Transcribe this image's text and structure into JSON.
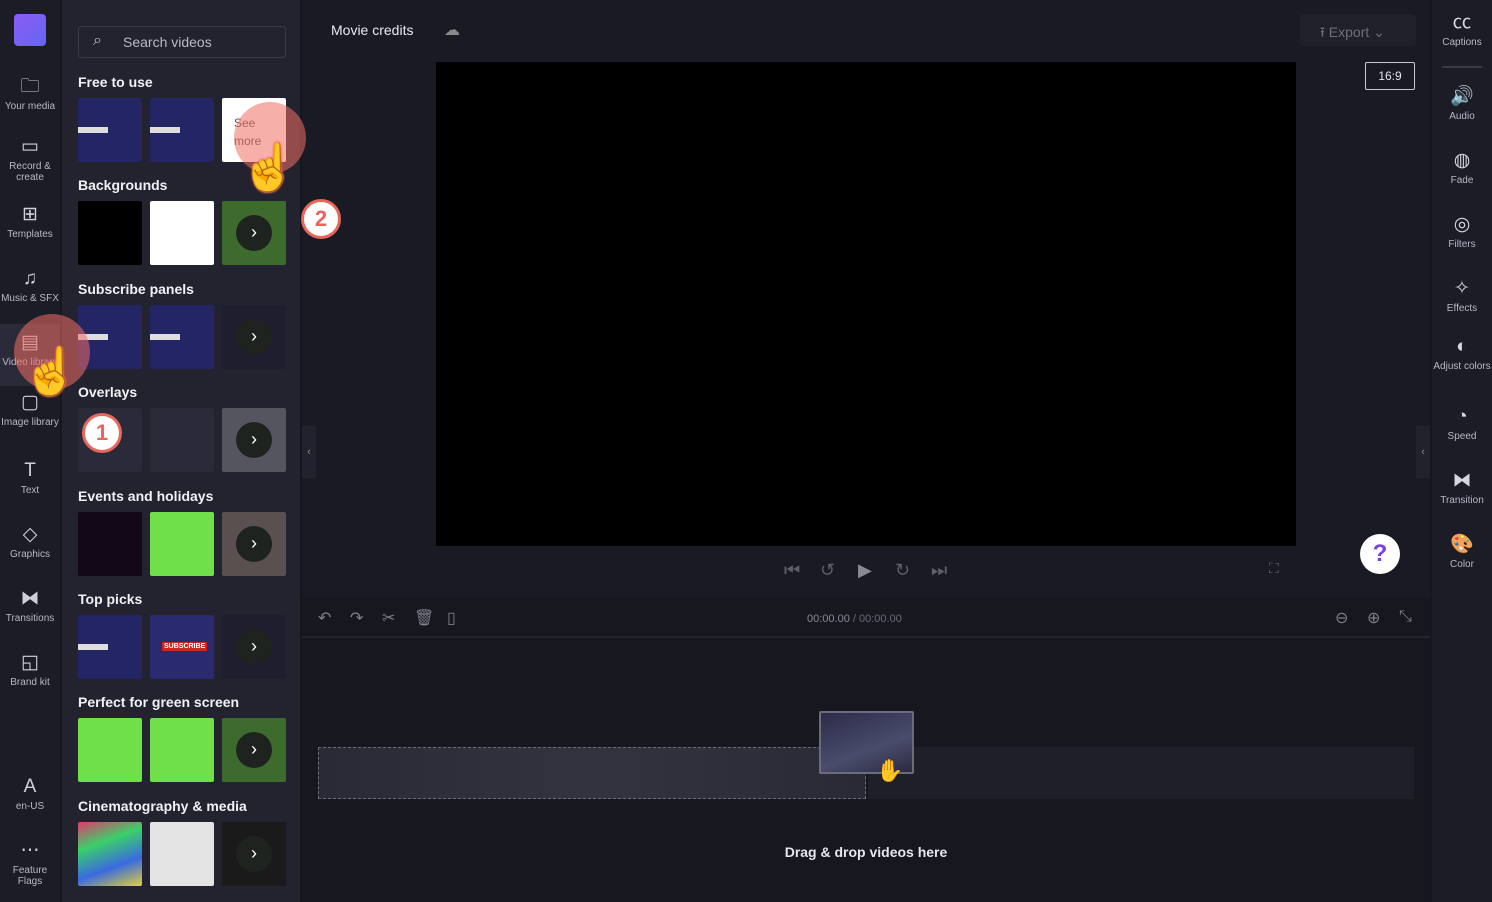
{
  "nav": {
    "items": [
      {
        "label": "Your media",
        "icon": "folder-icon",
        "glyph": "🗀"
      },
      {
        "label": "Record & create",
        "icon": "camera-icon",
        "glyph": "▭"
      },
      {
        "label": "Templates",
        "icon": "templates-icon",
        "glyph": "⊞"
      },
      {
        "label": "Music & SFX",
        "icon": "music-icon",
        "glyph": "♫"
      },
      {
        "label": "Video library",
        "icon": "film-icon",
        "glyph": "▤"
      },
      {
        "label": "Image library",
        "icon": "image-icon",
        "glyph": "▢"
      },
      {
        "label": "Text",
        "icon": "text-icon",
        "glyph": "T"
      },
      {
        "label": "Graphics",
        "icon": "shapes-icon",
        "glyph": "◇"
      },
      {
        "label": "Transitions",
        "icon": "transitions-icon",
        "glyph": "⧓"
      },
      {
        "label": "Brand kit",
        "icon": "brand-icon",
        "glyph": "◱"
      },
      {
        "label": "en-US",
        "icon": "language-icon",
        "glyph": "A"
      },
      {
        "label": "Feature Flags",
        "icon": "more-icon",
        "glyph": "⋯"
      }
    ],
    "active": "Video library"
  },
  "panel": {
    "search_placeholder": "Search videos",
    "see_more": "See more",
    "sections": [
      "Free to use",
      "Backgrounds",
      "Subscribe panels",
      "Overlays",
      "Events and holidays",
      "Top picks",
      "Perfect for green screen",
      "Cinematography & media"
    ],
    "thumb_text": "SUBSCRIBE"
  },
  "editor": {
    "project_title": "Movie credits",
    "export_label": "Export",
    "aspect_ratio": "16:9",
    "help": "?"
  },
  "timeline": {
    "current_time": "00:00.00",
    "total_time": "/ 00:00.00",
    "drop_hint": "Drag & drop videos here"
  },
  "rail": {
    "items": [
      {
        "label": "Captions",
        "icon": "captions-icon",
        "glyph": "㏄"
      },
      {
        "label": "Audio",
        "icon": "speaker-icon",
        "glyph": "🔊"
      },
      {
        "label": "Fade",
        "icon": "fade-icon",
        "glyph": "◍"
      },
      {
        "label": "Filters",
        "icon": "filters-icon",
        "glyph": "◎"
      },
      {
        "label": "Effects",
        "icon": "magic-wand-icon",
        "glyph": "✧"
      },
      {
        "label": "Adjust colors",
        "icon": "contrast-icon",
        "glyph": "◐"
      },
      {
        "label": "Speed",
        "icon": "speedometer-icon",
        "glyph": "◔"
      },
      {
        "label": "Transition",
        "icon": "transition-icon",
        "glyph": "⧓"
      },
      {
        "label": "Color",
        "icon": "palette-icon",
        "glyph": "🎨"
      }
    ]
  },
  "annotations": {
    "step1": "1",
    "step2": "2"
  },
  "colors": {
    "accent": "#7b3fe4",
    "annotation": "#e8665a",
    "green": "#6fe04a"
  }
}
